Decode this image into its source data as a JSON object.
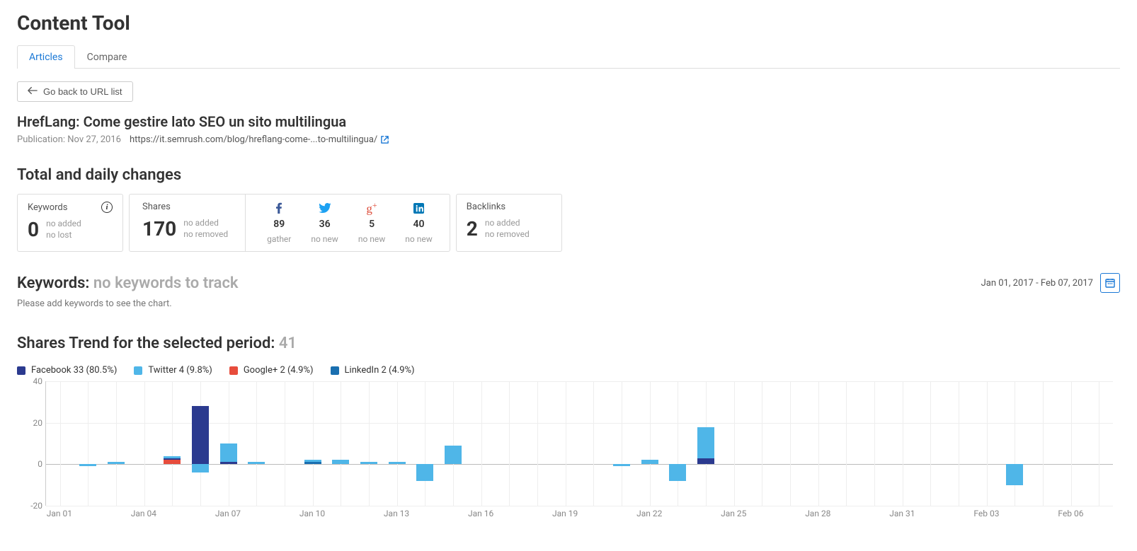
{
  "page_title": "Content Tool",
  "tabs": {
    "articles": "Articles",
    "compare": "Compare"
  },
  "go_back": "Go back to URL list",
  "article": {
    "title": "HrefLang: Come gestire lato SEO un sito multilingua",
    "publication_label": "Publication: Nov 27, 2016",
    "url": "https://it.semrush.com/blog/hreflang-come-...to-multilingua/"
  },
  "totals": {
    "heading": "Total and daily changes",
    "keywords": {
      "label": "Keywords",
      "value": "0",
      "d1": "no added",
      "d2": "no lost"
    },
    "shares": {
      "label": "Shares",
      "value": "170",
      "d1": "no added",
      "d2": "no removed",
      "networks": [
        {
          "name": "facebook",
          "num": "89",
          "sub": "gather"
        },
        {
          "name": "twitter",
          "num": "36",
          "sub": "no new"
        },
        {
          "name": "gplus",
          "num": "5",
          "sub": "no new"
        },
        {
          "name": "linkedin",
          "num": "40",
          "sub": "no new"
        }
      ]
    },
    "backlinks": {
      "label": "Backlinks",
      "value": "2",
      "d1": "no added",
      "d2": "no removed"
    }
  },
  "keywords_section": {
    "heading": "Keywords:",
    "muted": "no keywords to track",
    "note": "Please add keywords to see the chart.",
    "date_range": "Jan 01, 2017 - Feb 07, 2017"
  },
  "shares_trend": {
    "heading": "Shares Trend for the selected period:",
    "value": "41",
    "legend": {
      "facebook": "Facebook 33 (80.5%)",
      "twitter": "Twitter 4 (9.8%)",
      "gplus": "Google+ 2 (4.9%)",
      "linkedin": "LinkedIn 2 (4.9%)"
    }
  },
  "colors": {
    "facebook": "#2b3a8f",
    "twitter": "#4fb6e8",
    "gplus": "#e74c3c",
    "linkedin": "#1a6fb0"
  },
  "chart_data": {
    "type": "bar",
    "ylim": [
      -20,
      40
    ],
    "yticks": [
      -20,
      0,
      20,
      40
    ],
    "x_tick_labels": [
      "Jan 01",
      "Jan 04",
      "Jan 07",
      "Jan 10",
      "Jan 13",
      "Jan 16",
      "Jan 19",
      "Jan 22",
      "Jan 25",
      "Jan 28",
      "Jan 31",
      "Feb 03",
      "Feb 06"
    ],
    "x_tick_indices": [
      0,
      3,
      6,
      9,
      12,
      15,
      18,
      21,
      24,
      27,
      30,
      33,
      36
    ],
    "n_days": 38,
    "series_order": [
      "gplus",
      "linkedin",
      "facebook",
      "twitter"
    ],
    "data": [
      {
        "i": 1,
        "facebook": 0,
        "twitter": -1,
        "gplus": 0,
        "linkedin": 0
      },
      {
        "i": 2,
        "facebook": 0,
        "twitter": 1,
        "gplus": 0,
        "linkedin": 0
      },
      {
        "i": 4,
        "facebook": 1,
        "twitter": 1,
        "gplus": 2,
        "linkedin": 0
      },
      {
        "i": 5,
        "facebook": 28,
        "twitter": -4,
        "gplus": 0,
        "linkedin": 0
      },
      {
        "i": 6,
        "facebook": 1,
        "twitter": 9,
        "gplus": 0,
        "linkedin": 0
      },
      {
        "i": 7,
        "facebook": 0,
        "twitter": 1,
        "gplus": 0,
        "linkedin": 0
      },
      {
        "i": 9,
        "facebook": 0,
        "twitter": 1,
        "gplus": 0,
        "linkedin": 1
      },
      {
        "i": 10,
        "facebook": 0,
        "twitter": 2,
        "gplus": 0,
        "linkedin": 0
      },
      {
        "i": 11,
        "facebook": 0,
        "twitter": 1,
        "gplus": 0,
        "linkedin": 0
      },
      {
        "i": 12,
        "facebook": 0,
        "twitter": 1,
        "gplus": 0,
        "linkedin": 0
      },
      {
        "i": 13,
        "facebook": 0,
        "twitter": -8,
        "gplus": 0,
        "linkedin": 0
      },
      {
        "i": 14,
        "facebook": 0,
        "twitter": 9,
        "gplus": 0,
        "linkedin": 0
      },
      {
        "i": 20,
        "facebook": 0,
        "twitter": -1,
        "gplus": 0,
        "linkedin": 0
      },
      {
        "i": 21,
        "facebook": 0,
        "twitter": 2,
        "gplus": 0,
        "linkedin": 0
      },
      {
        "i": 22,
        "facebook": 0,
        "twitter": -8,
        "gplus": 0,
        "linkedin": 0
      },
      {
        "i": 23,
        "facebook": 3,
        "twitter": 15,
        "gplus": 0,
        "linkedin": 0
      },
      {
        "i": 34,
        "facebook": 0,
        "twitter": -10,
        "gplus": 0,
        "linkedin": 0
      }
    ]
  }
}
